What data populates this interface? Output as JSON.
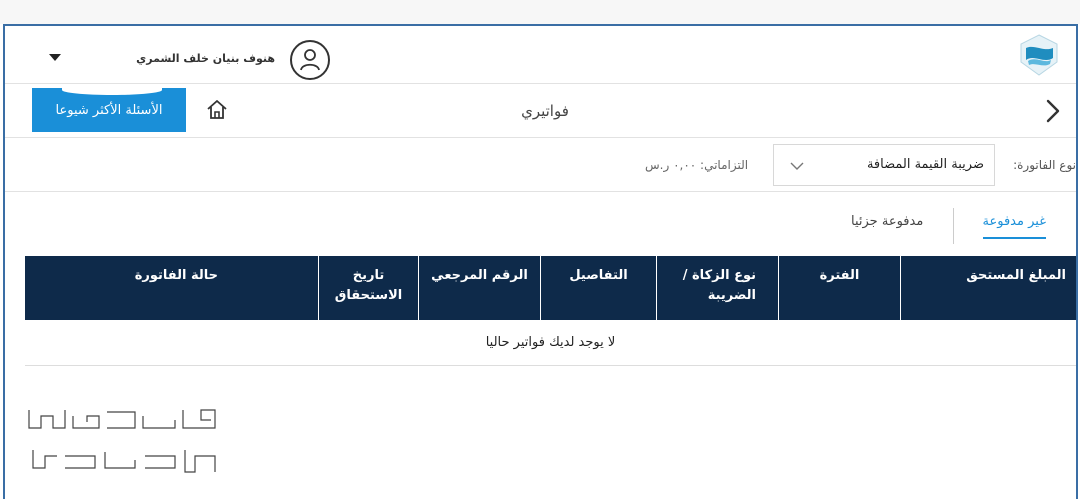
{
  "header": {
    "user_name": "هنوف بنيان خلف الشمري",
    "logo_icon": "agency-logo",
    "avatar_icon": "user-icon",
    "dropdown_icon": "caret-down-icon"
  },
  "nav": {
    "faq_label": "الأسئلة الأكثر شيوعا",
    "title": "فواتيري",
    "home_icon": "home-icon",
    "back_icon": "chevron-right-icon"
  },
  "filter": {
    "invoice_type_label": "نوع الفاتورة:",
    "invoice_type_value": "ضريبة القيمة المضافة",
    "commitments_text": "التزاماتي: ٠,٠٠ ر.س"
  },
  "tabs": {
    "unpaid": "غير مدفوعة",
    "partial": "مدفوعة جزئيا"
  },
  "table": {
    "columns": [
      "المبلغ المستحق",
      "الفترة",
      "نوع الزكاة / الضريبة",
      "التفاصيل",
      "الرقم المرجعي",
      "تاريخ الاستحقاق",
      "حالة الفاتورة"
    ],
    "empty_message": "لا يوجد لديك فواتير حاليا"
  },
  "colors": {
    "accent": "#1a8fd8",
    "table_header": "#0e2a4a",
    "frame": "#3a6ea5"
  }
}
